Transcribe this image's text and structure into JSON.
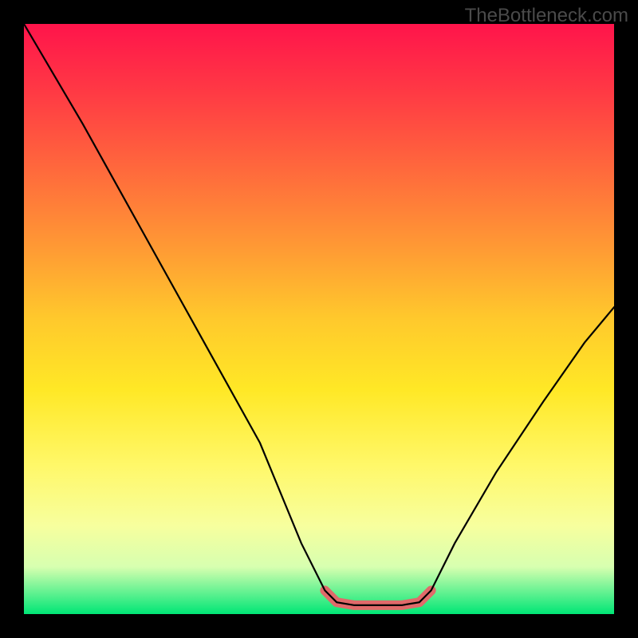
{
  "watermark": "TheBottleneck.com",
  "chart_data": {
    "type": "line",
    "title": "",
    "xlabel": "",
    "ylabel": "",
    "xlim": [
      0,
      100
    ],
    "ylim": [
      0,
      100
    ],
    "gradient_stops": [
      {
        "pos": 0,
        "color": "#ff144b"
      },
      {
        "pos": 12,
        "color": "#ff3b44"
      },
      {
        "pos": 25,
        "color": "#ff6a3c"
      },
      {
        "pos": 38,
        "color": "#ff9a34"
      },
      {
        "pos": 50,
        "color": "#ffc92c"
      },
      {
        "pos": 62,
        "color": "#ffe826"
      },
      {
        "pos": 75,
        "color": "#fff86a"
      },
      {
        "pos": 85,
        "color": "#f7ff9e"
      },
      {
        "pos": 92,
        "color": "#d7ffb0"
      },
      {
        "pos": 100,
        "color": "#00e676"
      }
    ],
    "series": [
      {
        "name": "bottleneck-curve",
        "color": "#000000",
        "points": [
          {
            "x": 0,
            "y": 100
          },
          {
            "x": 10,
            "y": 83
          },
          {
            "x": 20,
            "y": 65
          },
          {
            "x": 30,
            "y": 47
          },
          {
            "x": 40,
            "y": 29
          },
          {
            "x": 47,
            "y": 12
          },
          {
            "x": 51,
            "y": 4
          },
          {
            "x": 53,
            "y": 2
          },
          {
            "x": 56,
            "y": 1.5
          },
          {
            "x": 60,
            "y": 1.5
          },
          {
            "x": 64,
            "y": 1.5
          },
          {
            "x": 67,
            "y": 2
          },
          {
            "x": 69,
            "y": 4
          },
          {
            "x": 73,
            "y": 12
          },
          {
            "x": 80,
            "y": 24
          },
          {
            "x": 88,
            "y": 36
          },
          {
            "x": 95,
            "y": 46
          },
          {
            "x": 100,
            "y": 52
          }
        ]
      },
      {
        "name": "highlight-segment",
        "color": "#e06a6a",
        "stroke_width": 10,
        "points": [
          {
            "x": 51,
            "y": 4
          },
          {
            "x": 53,
            "y": 2
          },
          {
            "x": 56,
            "y": 1.5
          },
          {
            "x": 60,
            "y": 1.5
          },
          {
            "x": 64,
            "y": 1.5
          },
          {
            "x": 67,
            "y": 2
          },
          {
            "x": 69,
            "y": 4
          }
        ]
      }
    ]
  }
}
